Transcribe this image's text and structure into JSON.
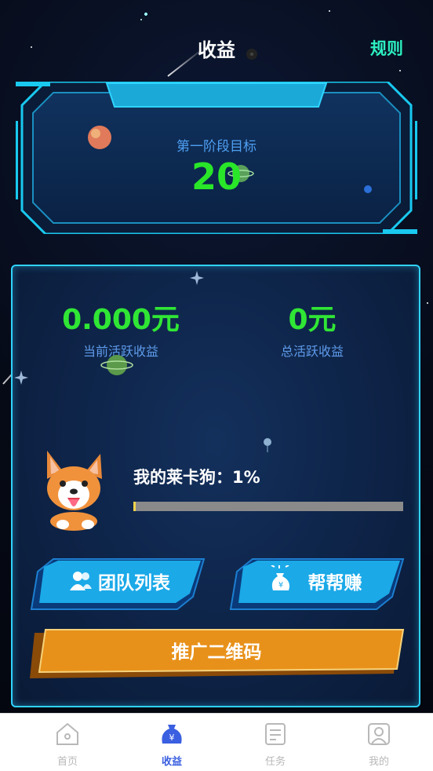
{
  "header": {
    "title": "收益",
    "rules_label": "规则"
  },
  "goal": {
    "label": "第一阶段目标",
    "value": "20"
  },
  "stats": {
    "current": {
      "value": "0.000元",
      "label": "当前活跃收益"
    },
    "total": {
      "value": "0元",
      "label": "总活跃收益"
    }
  },
  "pet": {
    "label": "我的莱卡狗：1%",
    "progress_fraction": 0.01
  },
  "buttons": {
    "team_list": "团队列表",
    "help_earn": "帮帮赚",
    "qr_code": "推广二维码"
  },
  "nav": {
    "items": [
      {
        "label": "首页",
        "icon": "home-icon",
        "active": false
      },
      {
        "label": "收益",
        "icon": "money-bag-icon",
        "active": true
      },
      {
        "label": "任务",
        "icon": "task-list-icon",
        "active": false
      },
      {
        "label": "我的",
        "icon": "profile-icon",
        "active": false
      }
    ]
  },
  "colors": {
    "accent_cyan": "#2fd3ff",
    "value_green": "#30e635",
    "label_blue": "#5e9bea",
    "orange": "#e8911a",
    "nav_active": "#3a5fe0"
  }
}
